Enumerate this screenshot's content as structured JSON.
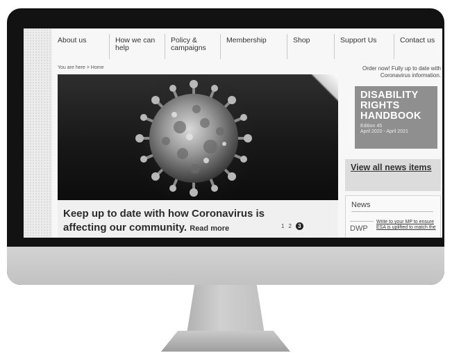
{
  "nav": {
    "items": [
      {
        "label": "About us"
      },
      {
        "label": "How we can help"
      },
      {
        "label": "Policy & campaigns"
      },
      {
        "label": "Membership"
      },
      {
        "label": "Shop"
      },
      {
        "label": "Support Us"
      },
      {
        "label": "Contact us"
      }
    ]
  },
  "breadcrumb": "You are here > Home",
  "hero": {
    "title": "Keep up to date with how Coronavirus is affecting our community.",
    "read_more": "Read more",
    "pages": [
      "1",
      "2",
      "3"
    ],
    "active_page": "3"
  },
  "sidebar": {
    "order_text": "Order now! Fully up to date with Coronavirus information.",
    "handbook": {
      "title": "DISABILITY RIGHTS HANDBOOK",
      "edition": "Edition 45",
      "dates": "April 2020 - April 2021"
    },
    "view_all": "View all news items",
    "news": {
      "heading": "News",
      "logo": "DWP",
      "item": "Write to your MP to ensure ESA is uplifted to match the"
    }
  },
  "icons": {
    "hero_image": "coronavirus-image",
    "page_curl": "page-curl-icon"
  },
  "colors": {
    "handbook_bg": "#8f8f8f",
    "hero_bg": "#1a1a1a",
    "bezel": "#121212"
  }
}
